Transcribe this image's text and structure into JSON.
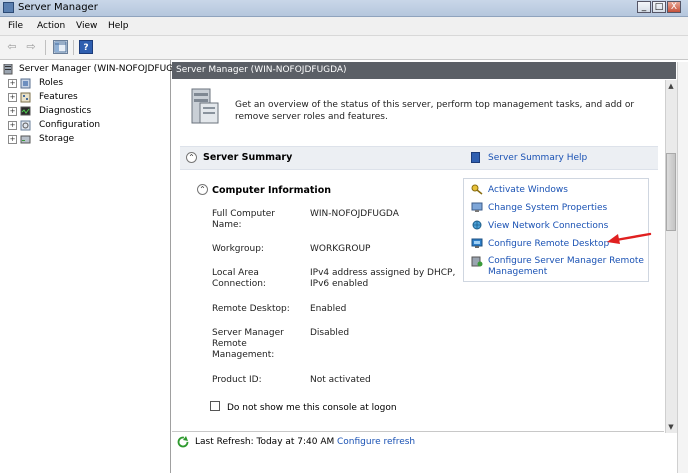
{
  "window": {
    "title": "Server Manager",
    "min_symbol": "_",
    "max_symbol": "□",
    "close_symbol": "X"
  },
  "menu": [
    "File",
    "Action",
    "View",
    "Help"
  ],
  "toolbar": {
    "back_symbol": "⇦",
    "forward_symbol": "⇨",
    "help_symbol": "?"
  },
  "tree": {
    "root": "Server Manager (WIN-NOFOJDFUGDA)",
    "root_display": "Server Manager (WIN-NOFOJDFUG",
    "expander": "+",
    "items": [
      "Roles",
      "Features",
      "Diagnostics",
      "Configuration",
      "Storage"
    ]
  },
  "header": {
    "title": "Server Manager (WIN-NOFOJDFUGDA)"
  },
  "intro": "Get an overview of the status of this server, perform top management tasks, and add or remove server roles and features.",
  "summary": {
    "title": "Server Summary",
    "help_link": "Server Summary Help",
    "collapse_symbol": "⌃"
  },
  "computer_info": {
    "title": "Computer Information",
    "rows": [
      {
        "label": "Full Computer Name:",
        "value": "WIN-NOFOJDFUGDA"
      },
      {
        "label": "Workgroup:",
        "value": "WORKGROUP"
      },
      {
        "label": "Local Area Connection:",
        "value": "IPv4 address assigned by DHCP, IPv6 enabled"
      },
      {
        "label": "Remote Desktop:",
        "value": "Enabled"
      },
      {
        "label": "Server Manager Remote Management:",
        "value": "Disabled"
      },
      {
        "label": "Product ID:",
        "value": "Not activated"
      }
    ]
  },
  "tasks": [
    {
      "label": "Activate Windows",
      "icon": "key-icon"
    },
    {
      "label": "Change System Properties",
      "icon": "system-properties-icon"
    },
    {
      "label": "View Network Connections",
      "icon": "network-icon"
    },
    {
      "label": "Configure Remote Desktop",
      "icon": "remote-desktop-icon"
    },
    {
      "label": "Configure Server Manager Remote Management",
      "icon": "remote-management-icon"
    }
  ],
  "logon_checkbox_label": "Do not show me this console at logon",
  "footer": {
    "last_refresh": "Last Refresh: Today at 7:40 AM",
    "configure_refresh": "Configure refresh"
  },
  "scrollbar": {
    "up_symbol": "▲",
    "down_symbol": "▼"
  },
  "colors": {
    "link": "#1a52b4",
    "header_bg": "#5b5f66",
    "annotation_arrow": "#e02020"
  }
}
